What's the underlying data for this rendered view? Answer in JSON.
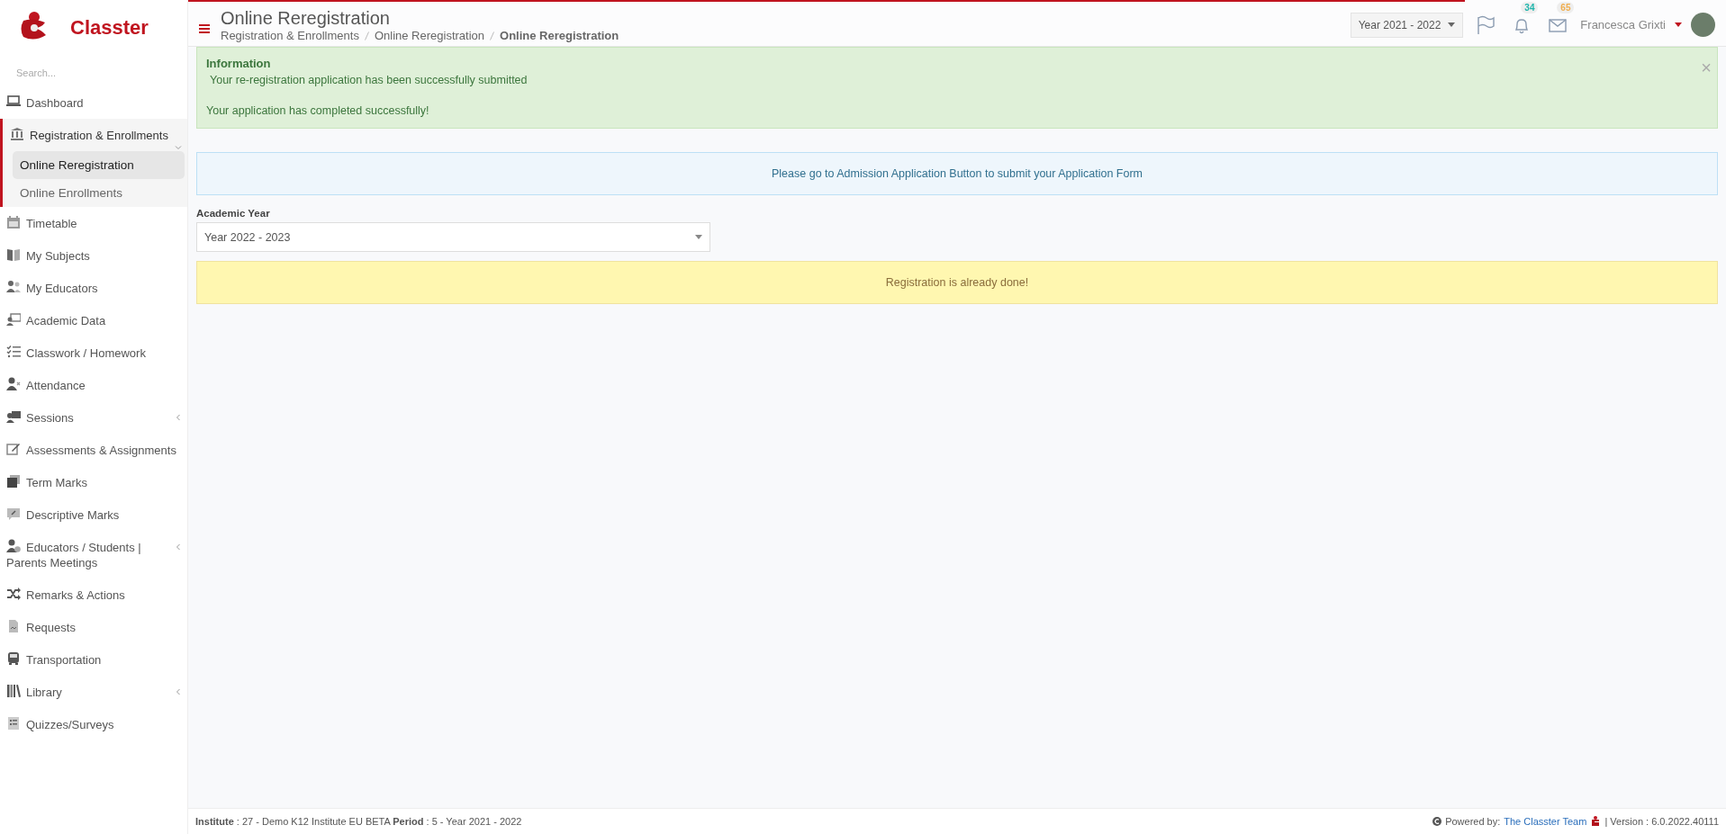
{
  "brand": {
    "name": "Classter"
  },
  "search": {
    "placeholder": "Search..."
  },
  "sidebar": {
    "items": [
      {
        "label": "Dashboard",
        "kind": "laptop",
        "selected": false
      },
      {
        "label": "Registration & Enrollments",
        "kind": "bank",
        "selected": true,
        "expanded": true,
        "children": [
          {
            "label": "Online Reregistration",
            "selected": true
          },
          {
            "label": "Online Enrollments",
            "selected": false
          }
        ]
      },
      {
        "label": "Timetable",
        "kind": "calendar",
        "selected": false
      },
      {
        "label": "My Subjects",
        "kind": "book",
        "selected": false
      },
      {
        "label": "My Educators",
        "kind": "users",
        "selected": false
      },
      {
        "label": "Academic Data",
        "kind": "board",
        "selected": false
      },
      {
        "label": "Classwork / Homework",
        "kind": "tasks",
        "selected": false
      },
      {
        "label": "Attendance",
        "kind": "user-x",
        "selected": false
      },
      {
        "label": "Sessions",
        "kind": "presenter",
        "selected": false,
        "expanded": false
      },
      {
        "label": "Assessments & Assignments",
        "kind": "edit",
        "selected": false
      },
      {
        "label": "Term Marks",
        "kind": "stack",
        "selected": false
      },
      {
        "label": "Descriptive Marks",
        "kind": "comment",
        "selected": false
      },
      {
        "label": "Educators / Students | Parents Meetings",
        "kind": "user-clock",
        "selected": false,
        "expanded": false
      },
      {
        "label": "Remarks & Actions",
        "kind": "shuffle",
        "selected": false
      },
      {
        "label": "Requests",
        "kind": "file",
        "selected": false
      },
      {
        "label": "Transportation",
        "kind": "bus",
        "selected": false
      },
      {
        "label": "Library",
        "kind": "books",
        "selected": false,
        "expanded": false
      },
      {
        "label": "Quizzes/Surveys",
        "kind": "checklist",
        "selected": false
      }
    ]
  },
  "header": {
    "title": "Online Reregistration",
    "breadcrumbs": [
      "Registration & Enrollments",
      "Online Reregistration",
      "Online Reregistration"
    ],
    "year_selector": {
      "value": "Year 2021 - 2022"
    },
    "notifications": [
      {
        "kind": "flag"
      },
      {
        "kind": "bell",
        "count": "34",
        "color": "#1fb5ac"
      },
      {
        "kind": "envelope",
        "count": "65",
        "color": "#f0ad4e"
      }
    ],
    "user": {
      "name": "Francesca Grixti"
    }
  },
  "alert_success": {
    "title": "Information",
    "lines": [
      "Your re-registration application has been successfully submitted",
      "Your application has completed successfully!"
    ],
    "close": "×"
  },
  "info_message": "Please go to Admission Application Button to submit your Application Form",
  "academic_year": {
    "label": "Academic Year",
    "value": "Year 2022 - 2023"
  },
  "warning_message": "Registration is already done!",
  "footer": {
    "institute": "**Institute** : 27 - Demo K12 Institute EU BETA **Period** : 5 - Year 2021 - 2022",
    "powered_by": "Powered by:",
    "team_link": "The Classter Team",
    "version": "| Version : 6.0.2022.40111"
  }
}
